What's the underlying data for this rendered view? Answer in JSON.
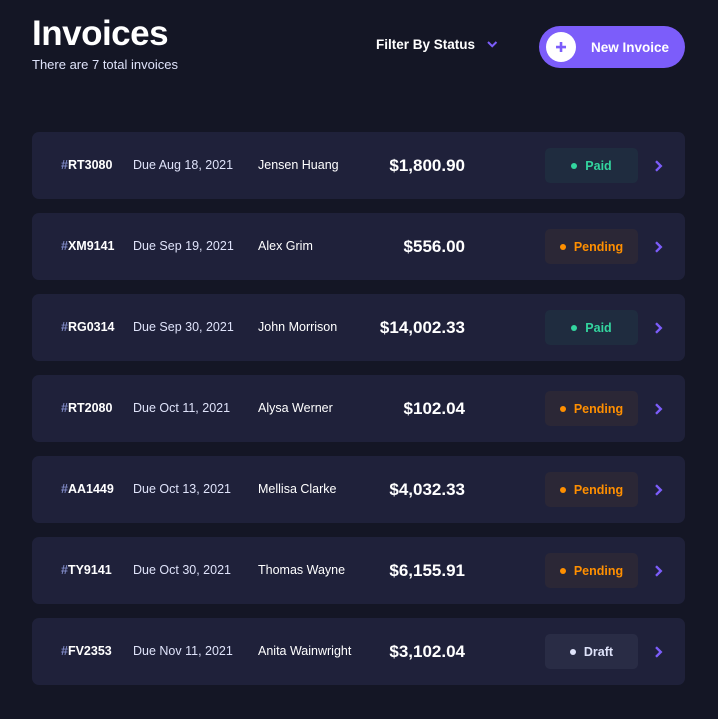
{
  "header": {
    "title": "Invoices",
    "subtitle": "There are 7 total invoices",
    "filter_label": "Filter By Status",
    "new_invoice_label": "New Invoice"
  },
  "colors": {
    "background": "#141625",
    "card": "#1f213a",
    "accent": "#7c5dfa",
    "paid": "#33d69f",
    "pending": "#ff8f00",
    "draft": "#dfe3fa"
  },
  "icons": {
    "filter": "chevron-down-icon",
    "new_invoice": "plus-icon",
    "row_action": "chevron-right-icon"
  },
  "invoices": [
    {
      "hash": "#",
      "id": "RT3080",
      "due": "Due Aug 18, 2021",
      "client": "Jensen Huang",
      "amount": "$1,800.90",
      "status": "Paid",
      "status_key": "paid"
    },
    {
      "hash": "#",
      "id": "XM9141",
      "due": "Due Sep 19, 2021",
      "client": "Alex Grim",
      "amount": "$556.00",
      "status": "Pending",
      "status_key": "pending"
    },
    {
      "hash": "#",
      "id": "RG0314",
      "due": "Due Sep 30, 2021",
      "client": "John Morrison",
      "amount": "$14,002.33",
      "status": "Paid",
      "status_key": "paid"
    },
    {
      "hash": "#",
      "id": "RT2080",
      "due": "Due Oct 11, 2021",
      "client": "Alysa Werner",
      "amount": "$102.04",
      "status": "Pending",
      "status_key": "pending"
    },
    {
      "hash": "#",
      "id": "AA1449",
      "due": "Due Oct 13, 2021",
      "client": "Mellisa Clarke",
      "amount": "$4,032.33",
      "status": "Pending",
      "status_key": "pending"
    },
    {
      "hash": "#",
      "id": "TY9141",
      "due": "Due Oct 30, 2021",
      "client": "Thomas Wayne",
      "amount": "$6,155.91",
      "status": "Pending",
      "status_key": "pending"
    },
    {
      "hash": "#",
      "id": "FV2353",
      "due": "Due Nov 11, 2021",
      "client": "Anita Wainwright",
      "amount": "$3,102.04",
      "status": "Draft",
      "status_key": "draft"
    }
  ]
}
